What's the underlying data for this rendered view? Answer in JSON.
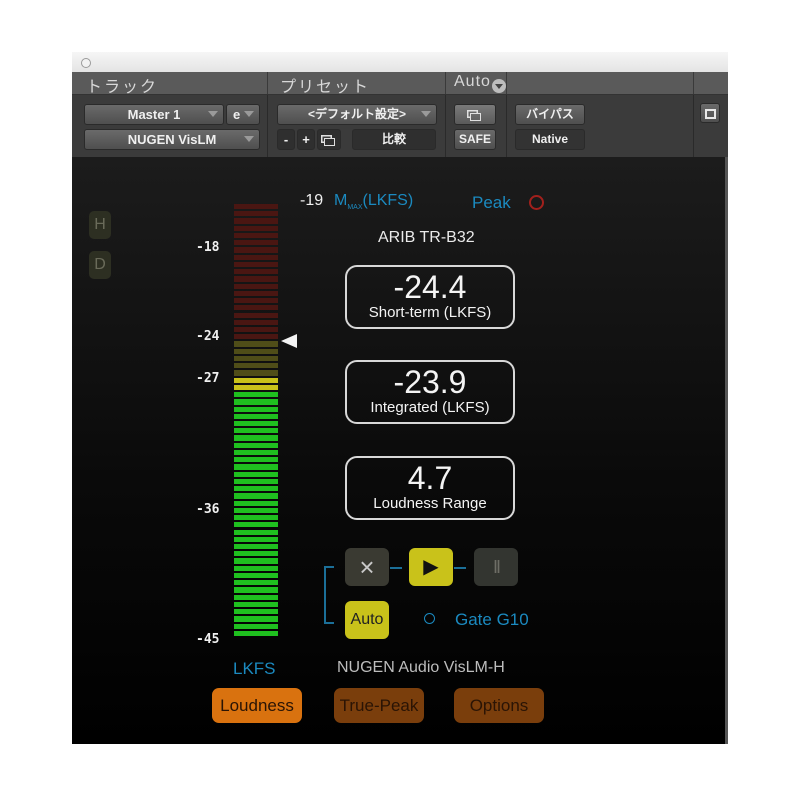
{
  "header": {
    "track_label": "トラック",
    "preset_label": "プリセット",
    "auto_label": "Auto"
  },
  "toolbar": {
    "track_select": "Master 1",
    "track_group": "e",
    "plugin_select": "NUGEN VisLM",
    "preset_select": "<デフォルト設定>",
    "preset_minus": "-",
    "preset_plus": "+",
    "compare_label": "比較",
    "safe_label": "SAFE",
    "bypass_label": "バイパス",
    "native_label": "Native"
  },
  "side_buttons": {
    "h": "H",
    "d": "D"
  },
  "meter": {
    "ticks": [
      "-18",
      "-24",
      "-27",
      "-36",
      "-45"
    ],
    "unit_label": "LKFS",
    "range_db": [
      -45,
      -14
    ],
    "current_level_lkfs": -27,
    "target_lkfs": -24,
    "colors": {
      "green": "#1fc01f",
      "yellow": "#c9c21a",
      "dim_yellow": "#4f4d18",
      "dim_red": "#4a1612"
    }
  },
  "readouts": {
    "mmax_value": "-19",
    "mmax_label": "M",
    "mmax_sub": "MAX",
    "mmax_unit": "(LKFS)",
    "peak_label": "Peak",
    "standard": "ARIB TR-B32",
    "short_term_value": "-24.4",
    "short_term_label": "Short-term (LKFS)",
    "integrated_value": "-23.9",
    "integrated_label": "Integrated (LKFS)",
    "range_value": "4.7",
    "range_label": "Loudness Range"
  },
  "controls": {
    "reset_icon": "×",
    "play_icon": "▶",
    "pause_icon": "II",
    "auto_label": "Auto",
    "gate_label": "Gate G10"
  },
  "footer": {
    "product": "NUGEN Audio VisLM-H",
    "tabs": [
      {
        "label": "Loudness",
        "active": true
      },
      {
        "label": "True-Peak",
        "active": false
      },
      {
        "label": "Options",
        "active": false
      }
    ]
  },
  "colors": {
    "accent_blue": "#1b8ac0",
    "accent_yellow": "#c9c21a",
    "tab_active": "#d9720f",
    "tab_inactive": "#7a3e0c",
    "peak_ring": "#a2201c"
  }
}
